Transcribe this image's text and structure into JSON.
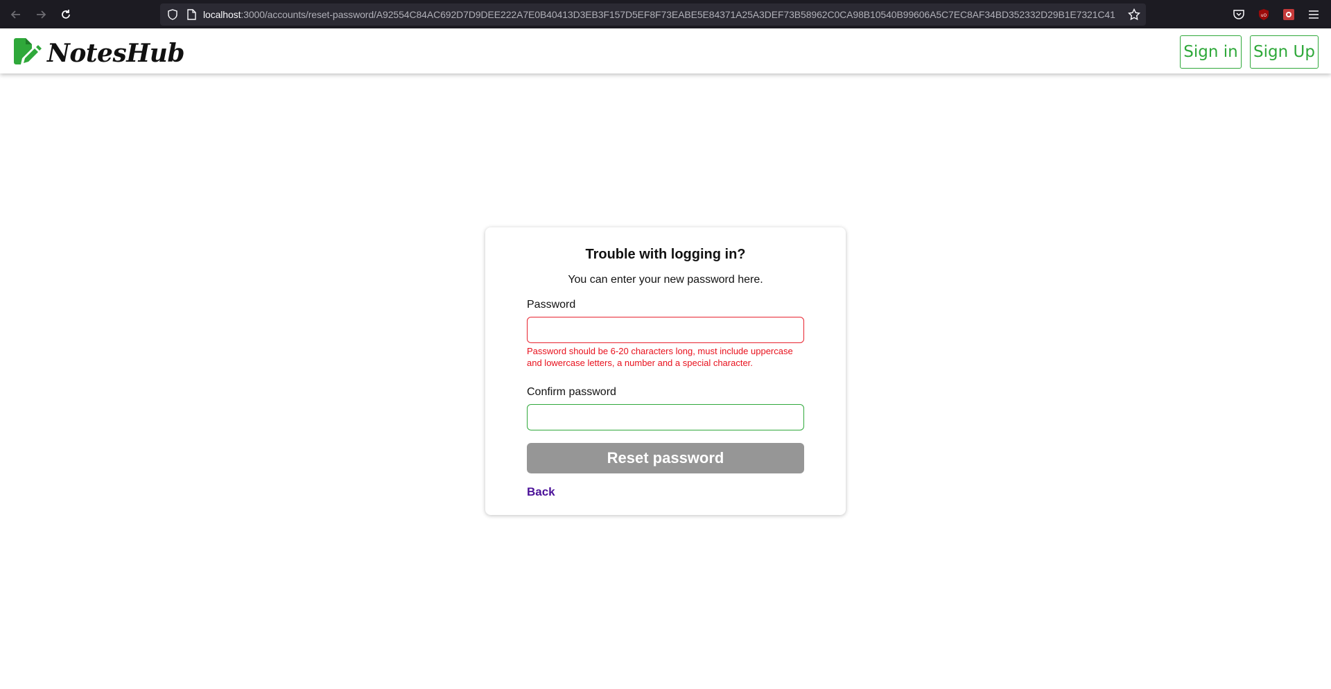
{
  "browser": {
    "url_host": "localhost",
    "url_path": ":3000/accounts/reset-password/A92554C84AC692D7D9DEE222A7E0B40413D3EB3F157D5EF8F73EABE5E84371A25A3DEF73B58962C0CA98B10540B99606A5C7EC8AF34BD352332D29B1E7321C41",
    "icons": [
      "back-icon",
      "forward-icon",
      "reload-icon",
      "shield-icon",
      "page-icon",
      "bookmark-star-icon",
      "pocket-icon",
      "ublock-icon",
      "extension-icon",
      "menu-icon"
    ]
  },
  "header": {
    "logo_text": "NotesHub",
    "sign_in": "Sign in",
    "sign_up": "Sign Up"
  },
  "card": {
    "title": "Trouble with logging in?",
    "subtitle": "You can enter your new password here.",
    "password_label": "Password",
    "password_value": "",
    "password_error": "Password should be 6-20 characters long, must include uppercase and lowercase letters, a number and a special character.",
    "confirm_label": "Confirm password",
    "confirm_value": "",
    "submit_label": "Reset password",
    "back_label": "Back"
  },
  "colors": {
    "brand_green": "#2fa83a",
    "error_red": "#e8222e",
    "button_disabled": "#969696",
    "link_purple": "#4b1299",
    "chrome_dark": "#1c1b22"
  }
}
